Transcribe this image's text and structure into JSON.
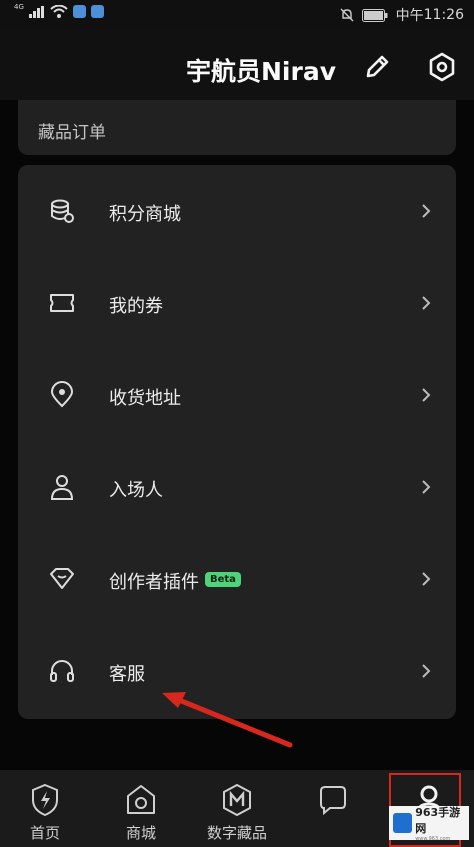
{
  "status_bar": {
    "network": "4G",
    "carrier_label": "中午",
    "time": "11:26"
  },
  "header": {
    "username": "宇航员Nirav",
    "edit_icon": "pencil-icon",
    "settings_icon": "hex-gear-icon"
  },
  "orders": {
    "title": "藏品订单"
  },
  "menu": {
    "items": [
      {
        "label": "积分商城",
        "icon": "coin-stack-icon"
      },
      {
        "label": "我的券",
        "icon": "ticket-icon"
      },
      {
        "label": "收货地址",
        "icon": "location-pin-icon"
      },
      {
        "label": "入场人",
        "icon": "person-icon"
      },
      {
        "label": "创作者插件",
        "icon": "diamond-badge-icon",
        "badge": "Beta"
      },
      {
        "label": "客服",
        "icon": "headset-icon"
      }
    ]
  },
  "tabbar": {
    "tabs": [
      {
        "label": "首页",
        "icon": "lightning-shield-icon"
      },
      {
        "label": "商城",
        "icon": "camera-house-icon"
      },
      {
        "label": "数字藏品",
        "icon": "m-hexagon-icon"
      },
      {
        "label": "",
        "icon": "chat-bubble-icon"
      },
      {
        "label": "",
        "icon": "profile-icon"
      }
    ]
  },
  "watermark": {
    "text": "963手游网",
    "sub": "www.963.com"
  },
  "colors": {
    "accent_beta": "#4ed27a",
    "annotation_red": "#d8281e"
  }
}
